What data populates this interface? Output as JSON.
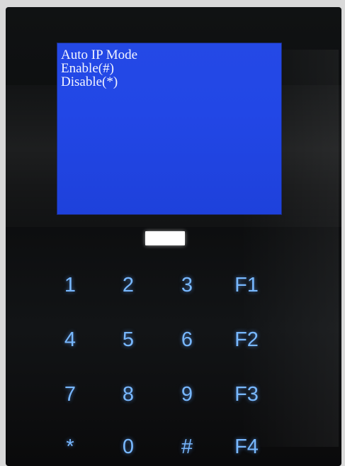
{
  "screen": {
    "lines": [
      "Auto IP Mode",
      "Enable(#)",
      "Disable(*)"
    ]
  },
  "keypad": {
    "rows": [
      [
        "1",
        "2",
        "3",
        "F1"
      ],
      [
        "4",
        "5",
        "6",
        "F2"
      ],
      [
        "7",
        "8",
        "9",
        "F3"
      ],
      [
        "*",
        "0",
        "#",
        "F4"
      ]
    ]
  },
  "colors": {
    "screen_bg": "#2247e6",
    "screen_text": "#f2f4ff",
    "key_glow": "#78b8ff",
    "device_body": "#0d0e10"
  }
}
